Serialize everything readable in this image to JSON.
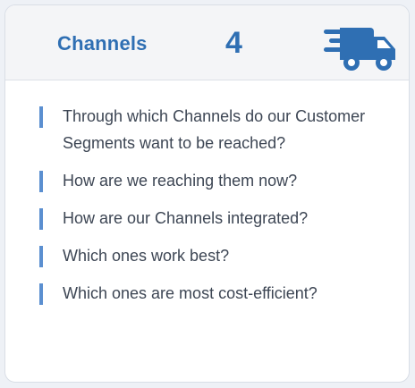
{
  "card": {
    "title": "Channels",
    "number": "4",
    "icon": "delivery-truck-icon",
    "accent_color": "#2f6fb3",
    "bar_color": "#5b8fd0"
  },
  "questions": [
    "Through which Channels do our Customer Segments want to be reached?",
    "How are we reaching them now?",
    "How are our Channels integrated?",
    "Which ones work best?",
    "Which ones are most cost-efficient?"
  ]
}
